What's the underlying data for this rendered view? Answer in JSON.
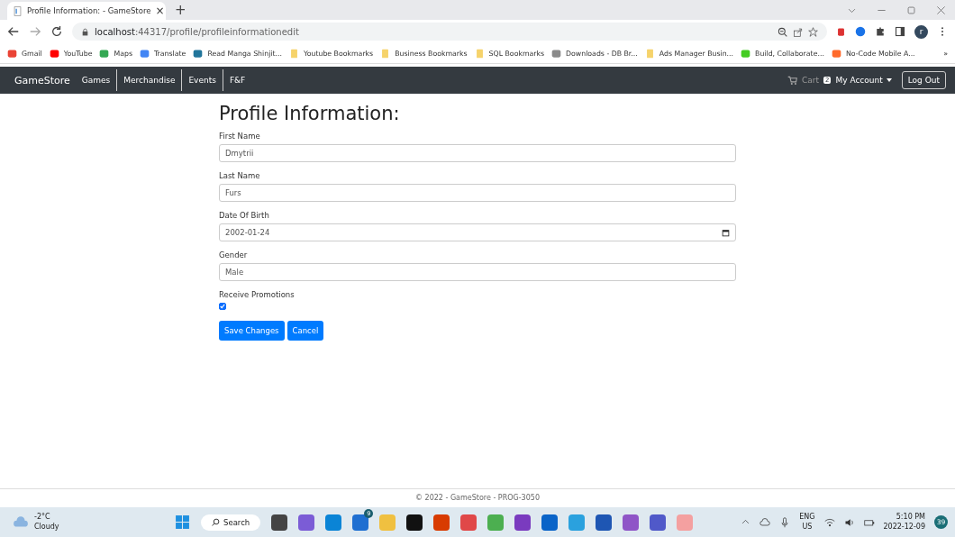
{
  "browser": {
    "tab": {
      "title": "Profile Information: - GameStore",
      "close": "×"
    },
    "new_tab": "+",
    "url_host": "localhost",
    "url_path": ":44317/profile/profileinformationedit",
    "bookmarks": [
      {
        "label": "Gmail",
        "kind": "site",
        "color": "#ea4335"
      },
      {
        "label": "YouTube",
        "kind": "site",
        "color": "#ff0000"
      },
      {
        "label": "Maps",
        "kind": "site",
        "color": "#34a853"
      },
      {
        "label": "Translate",
        "kind": "site",
        "color": "#4285f4"
      },
      {
        "label": "Read Manga Shinjit...",
        "kind": "site",
        "color": "#21759b"
      },
      {
        "label": "Youtube Bookmarks",
        "kind": "folder",
        "color": "#f6d36b"
      },
      {
        "label": "Business Bookmarks",
        "kind": "folder",
        "color": "#f6d36b"
      },
      {
        "label": "SQL Bookmarks",
        "kind": "folder",
        "color": "#f6d36b"
      },
      {
        "label": "Downloads - DB Br...",
        "kind": "site",
        "color": "#8a8a8a"
      },
      {
        "label": "Ads Manager Busin...",
        "kind": "folder",
        "color": "#f6d36b"
      },
      {
        "label": "Build, Collaborate...",
        "kind": "site",
        "color": "#44cc22"
      },
      {
        "label": "No-Code Mobile A...",
        "kind": "site",
        "color": "#ff6a2b"
      }
    ],
    "more": "»",
    "profile_initial": "r"
  },
  "navbar": {
    "brand": "GameStore",
    "links": [
      "Games",
      "Merchandise",
      "Events",
      "F&F"
    ],
    "cart": "Cart",
    "cart_count": "2",
    "account": "My Account",
    "logout": "Log Out"
  },
  "page": {
    "title": "Profile Information:",
    "fields": [
      {
        "label": "First Name",
        "value": "Dmytrii",
        "kind": "text"
      },
      {
        "label": "Last Name",
        "value": "Furs",
        "kind": "text"
      },
      {
        "label": "Date Of Birth",
        "value": "2002-01-24",
        "kind": "date"
      },
      {
        "label": "Gender",
        "value": "Male",
        "kind": "text"
      }
    ],
    "promotions": {
      "label": "Receive Promotions",
      "checked": true
    },
    "buttons": [
      "Save Changes",
      "Cancel"
    ]
  },
  "footer": "© 2022 - GameStore - PROG-3050",
  "taskbar": {
    "weather_temp": "-2°C",
    "weather_text": "Cloudy",
    "search": "Search",
    "mail_badge": "9",
    "lang_top": "ENG",
    "lang_bottom": "US",
    "time": "5:10 PM",
    "date": "2022-12-09",
    "notifications": "39"
  }
}
